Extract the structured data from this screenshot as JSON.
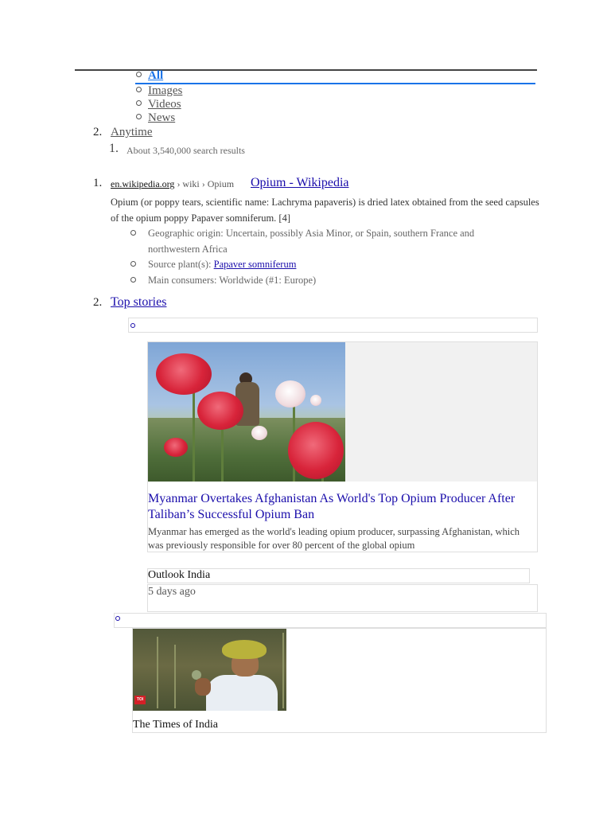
{
  "tabs": [
    {
      "label": "All",
      "active": true
    },
    {
      "label": "Images",
      "active": false
    },
    {
      "label": "Videos",
      "active": false
    },
    {
      "label": "News",
      "active": false
    }
  ],
  "filters": {
    "number": "2.",
    "anytime_label": "Anytime"
  },
  "result_count": {
    "number": "1.",
    "text": "About 3,540,000 search results"
  },
  "result": {
    "number": "1.",
    "site": "en.wikipedia.org",
    "path": " › wiki › Opium",
    "title": "Opium - Wikipedia",
    "snippet": "Opium (or poppy tears, scientific name: Lachryma papaveris) is dried latex obtained from the seed capsules of the opium poppy Papaver somniferum. [4]",
    "facts": [
      {
        "text": "Geographic origin: Uncertain, possibly Asia Minor, or Spain, southern France and northwestern Africa"
      },
      {
        "text": "Source plant(s): ",
        "link": "Papaver somniferum"
      },
      {
        "text": "Main consumers: Worldwide (#1: Europe)"
      }
    ]
  },
  "top_stories": {
    "number": "2.",
    "title": "Top stories",
    "stories": [
      {
        "title": "Myanmar Overtakes Afghanistan As World's Top Opium Producer After Taliban’s Successful Opium Ban",
        "snippet": "Myanmar has emerged as the world's leading opium producer, surpassing Afghanistan, which was previously responsible for over 80 percent of the global opium",
        "source": "Outlook India",
        "time": "5 days ago"
      },
      {
        "source": "The Times of India",
        "badge": "TOI"
      }
    ]
  },
  "colors": {
    "link": "#1a0dab",
    "active_tab": "#1a73e8",
    "muted_text": "#666666"
  }
}
